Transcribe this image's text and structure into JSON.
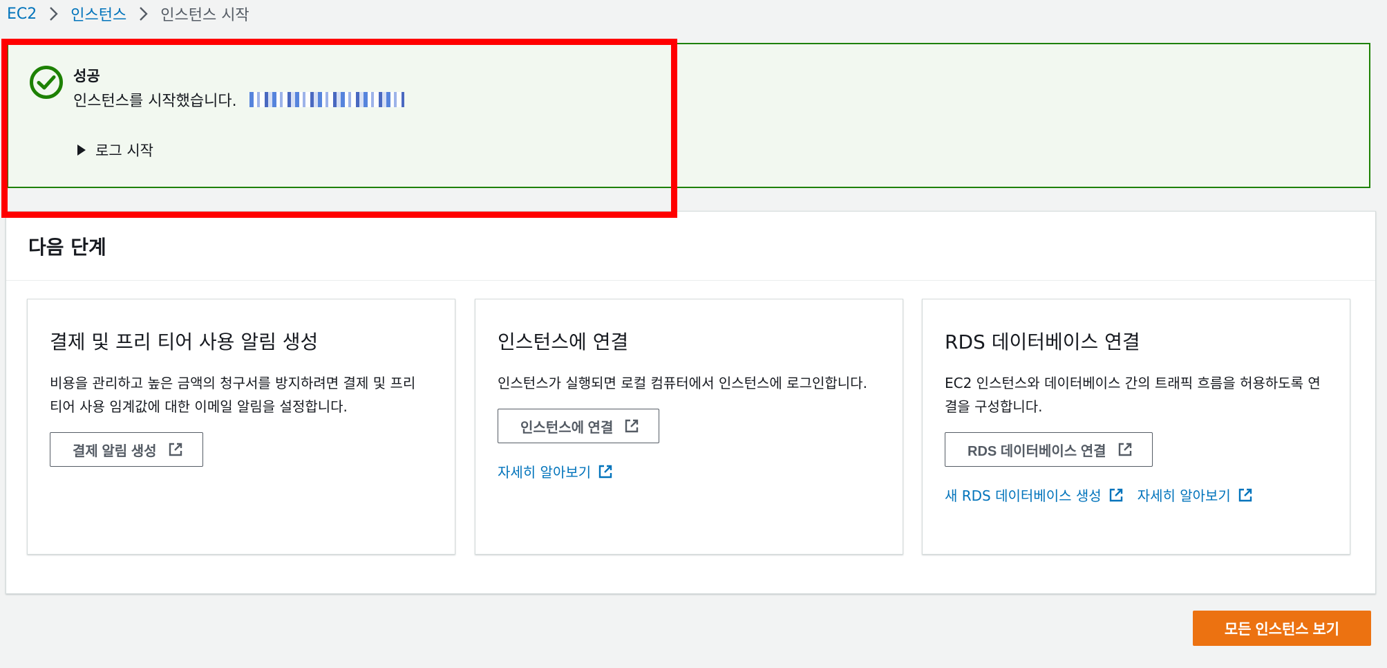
{
  "breadcrumb": {
    "items": [
      "EC2",
      "인스턴스"
    ],
    "current": "인스턴스 시작"
  },
  "flash": {
    "title": "성공",
    "message": "인스턴스를 시작했습니다.",
    "log_toggle": "로그 시작",
    "icon": "success-check-icon",
    "color": "#1d8102"
  },
  "next_steps": {
    "title": "다음 단계",
    "cards": [
      {
        "title": "결제 및 프리 티어 사용 알림 생성",
        "description": "비용을 관리하고 높은 금액의 청구서를 방지하려면 결제 및 프리 티어 사용 임계값에 대한 이메일 알림을 설정합니다.",
        "button": "결제 알림 생성"
      },
      {
        "title": "인스턴스에 연결",
        "description": "인스턴스가 실행되면 로컬 컴퓨터에서 인스턴스에 로그인합니다.",
        "button": "인스턴스에 연결",
        "links": [
          "자세히 알아보기"
        ]
      },
      {
        "title": "RDS 데이터베이스 연결",
        "description": "EC2 인스턴스와 데이터베이스 간의 트래픽 흐름을 허용하도록 연결을 구성합니다.",
        "button": "RDS 데이터베이스 연결",
        "links": [
          "새 RDS 데이터베이스 생성",
          "자세히 알아보기"
        ]
      }
    ]
  },
  "primary_button": "모든 인스턴스 보기",
  "colors": {
    "link": "#0073bb",
    "primary": "#ec7211",
    "success": "#1d8102",
    "highlight": "#ff0000"
  }
}
